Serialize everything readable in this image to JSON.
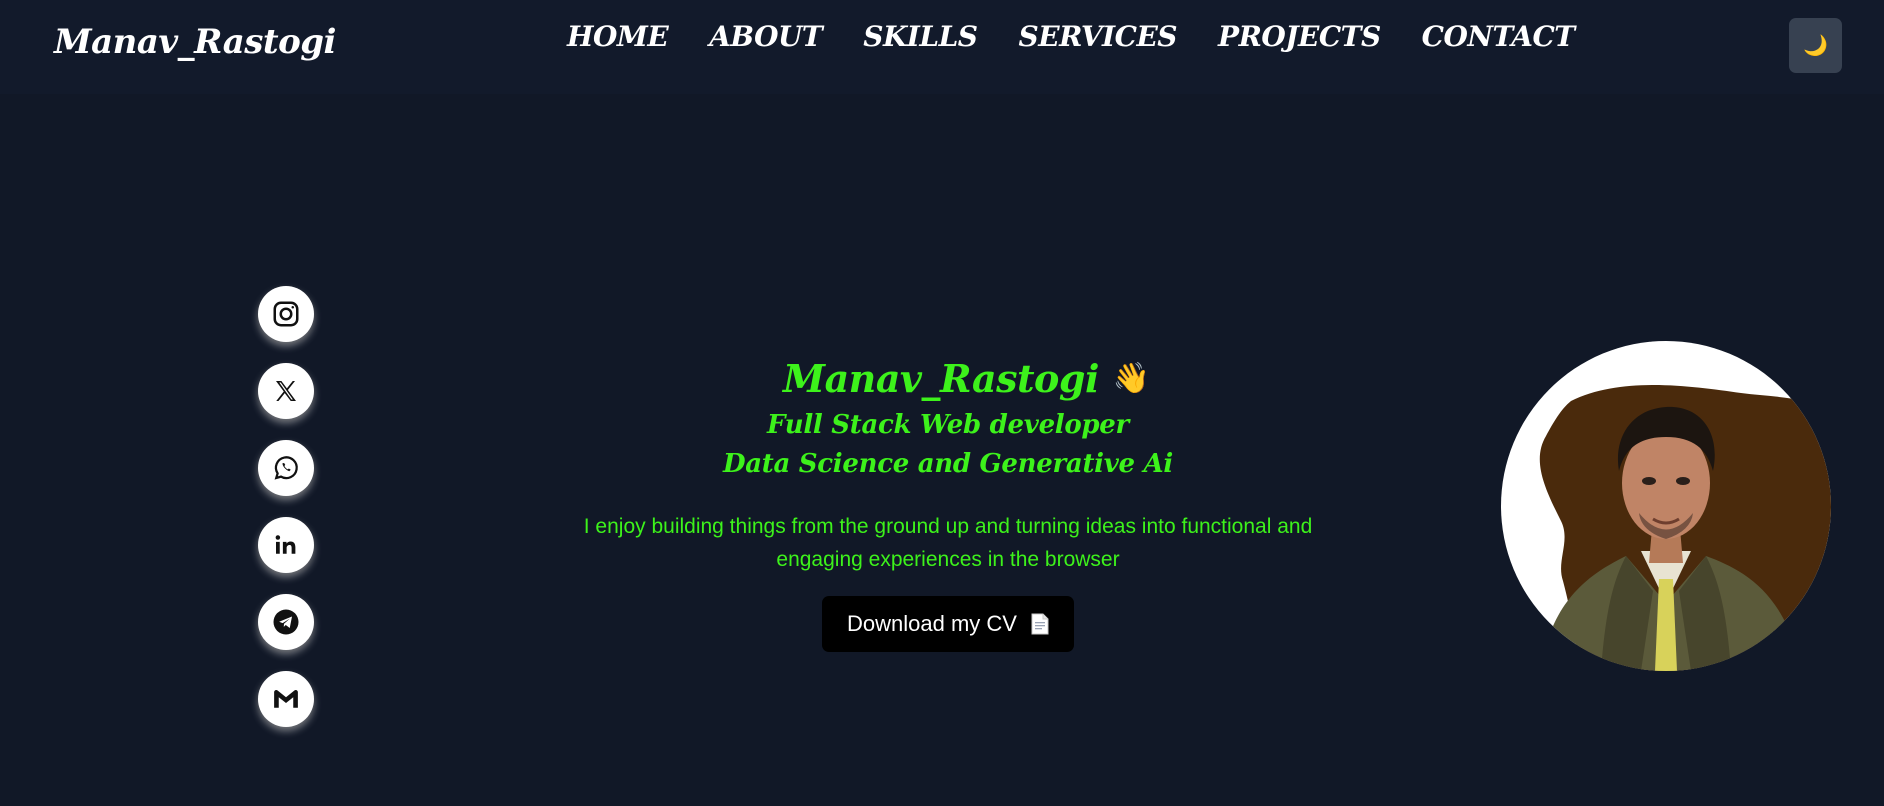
{
  "header": {
    "logo": "Manav_Rastogi",
    "nav": [
      "HOME",
      "ABOUT",
      "SKILLS",
      "SERVICES",
      "PROJECTS",
      "CONTACT"
    ],
    "theme_icon": "🌙"
  },
  "social": [
    {
      "icon": "instagram-icon"
    },
    {
      "icon": "x-icon"
    },
    {
      "icon": "whatsapp-icon"
    },
    {
      "icon": "linkedin-icon"
    },
    {
      "icon": "telegram-icon"
    },
    {
      "icon": "gmail-icon"
    }
  ],
  "hero": {
    "name": "Manav_Rastogi",
    "wave": "👋",
    "role1": "Full Stack Web developer",
    "role2": "Data Science and Generative Ai",
    "bio": "I enjoy building things from the ground up and turning ideas into functional and engaging experiences in the browser",
    "cv_label": "Download my CV"
  },
  "colors": {
    "background": "#111827",
    "header": "#121a2b",
    "accent": "#3df21b",
    "theme_button": "#374151"
  }
}
